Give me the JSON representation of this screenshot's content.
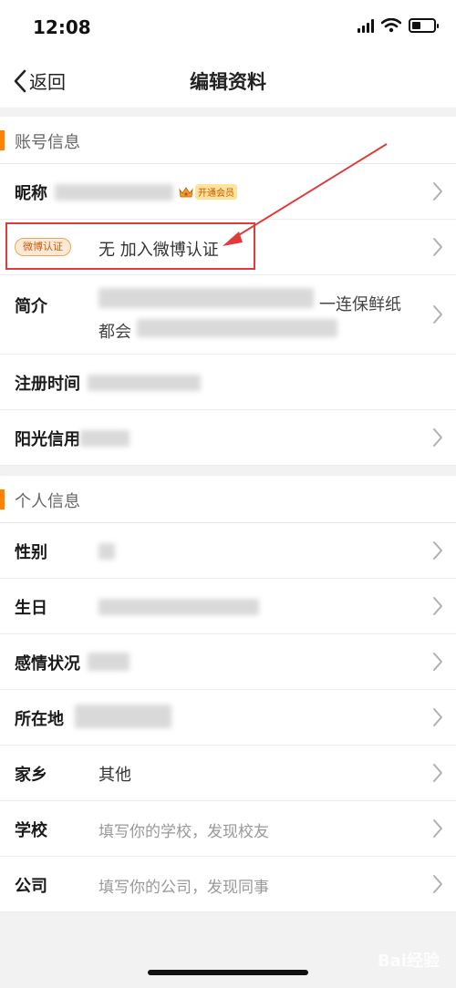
{
  "status": {
    "time": "12:08"
  },
  "nav": {
    "back_label": "返回",
    "title": "编辑资料"
  },
  "sections": {
    "account": "账号信息",
    "personal": "个人信息"
  },
  "account_rows": {
    "nickname": {
      "label": "昵称",
      "vip_label": "开通会员"
    },
    "weibo_verify": {
      "badge": "微博认证",
      "value": "无 加入微博认证"
    },
    "bio": {
      "label": "简介",
      "visible_fragment_1": "一连保鲜纸",
      "visible_fragment_2": "都会"
    },
    "register_time": {
      "label": "注册时间"
    },
    "sunshine_credit": {
      "label": "阳光信用"
    }
  },
  "personal_rows": {
    "gender": {
      "label": "性别"
    },
    "birthday": {
      "label": "生日"
    },
    "relationship": {
      "label": "感情状况"
    },
    "location": {
      "label": "所在地"
    },
    "hometown": {
      "label": "家乡",
      "value": "其他"
    },
    "school": {
      "label": "学校",
      "placeholder": "填写你的学校，发现校友"
    },
    "company": {
      "label": "公司",
      "placeholder": "填写你的公司，发现同事"
    }
  },
  "watermark": "Bai经验",
  "icons": {
    "back": "chevron-left-icon",
    "row": "chevron-right-icon",
    "signal": "signal-icon",
    "wifi": "wifi-icon",
    "battery": "battery-icon",
    "crown": "crown-icon"
  },
  "colors": {
    "accent": "#ff8200",
    "highlight": "#e03b3b",
    "badge_text": "#c85c10"
  }
}
